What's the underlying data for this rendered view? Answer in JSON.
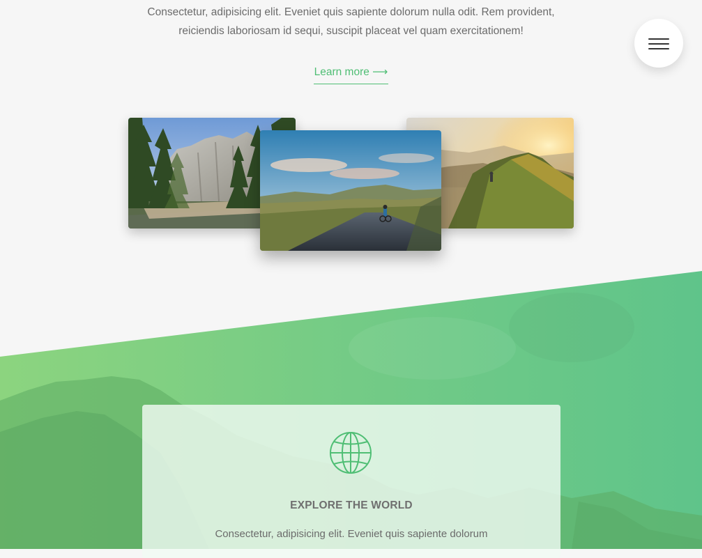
{
  "intro": {
    "line1": "Consectetur, adipisicing elit. Eveniet quis sapiente dolorum nulla odit. Rem provident,",
    "line2": "reiciendis laboriosam id sequi, suscipit placeat vel quam exercitationem!",
    "learn_more": "Learn more ⟶"
  },
  "menu": {
    "icon": "hamburger-menu-icon"
  },
  "gallery": {
    "left": "mountain-forest-river-photo",
    "center": "cyclist-road-hills-photo",
    "right": "hiker-ridge-sunset-photo"
  },
  "feature": {
    "icon": "globe-icon",
    "title": "EXPLORE THE WORLD",
    "text": "Consectetur, adipisicing elit. Eveniet quis sapiente dolorum"
  },
  "colors": {
    "accent": "#4fbe74",
    "background": "#f6f6f6",
    "green_light": "#8ad47e",
    "green_dark": "#5fc486"
  }
}
